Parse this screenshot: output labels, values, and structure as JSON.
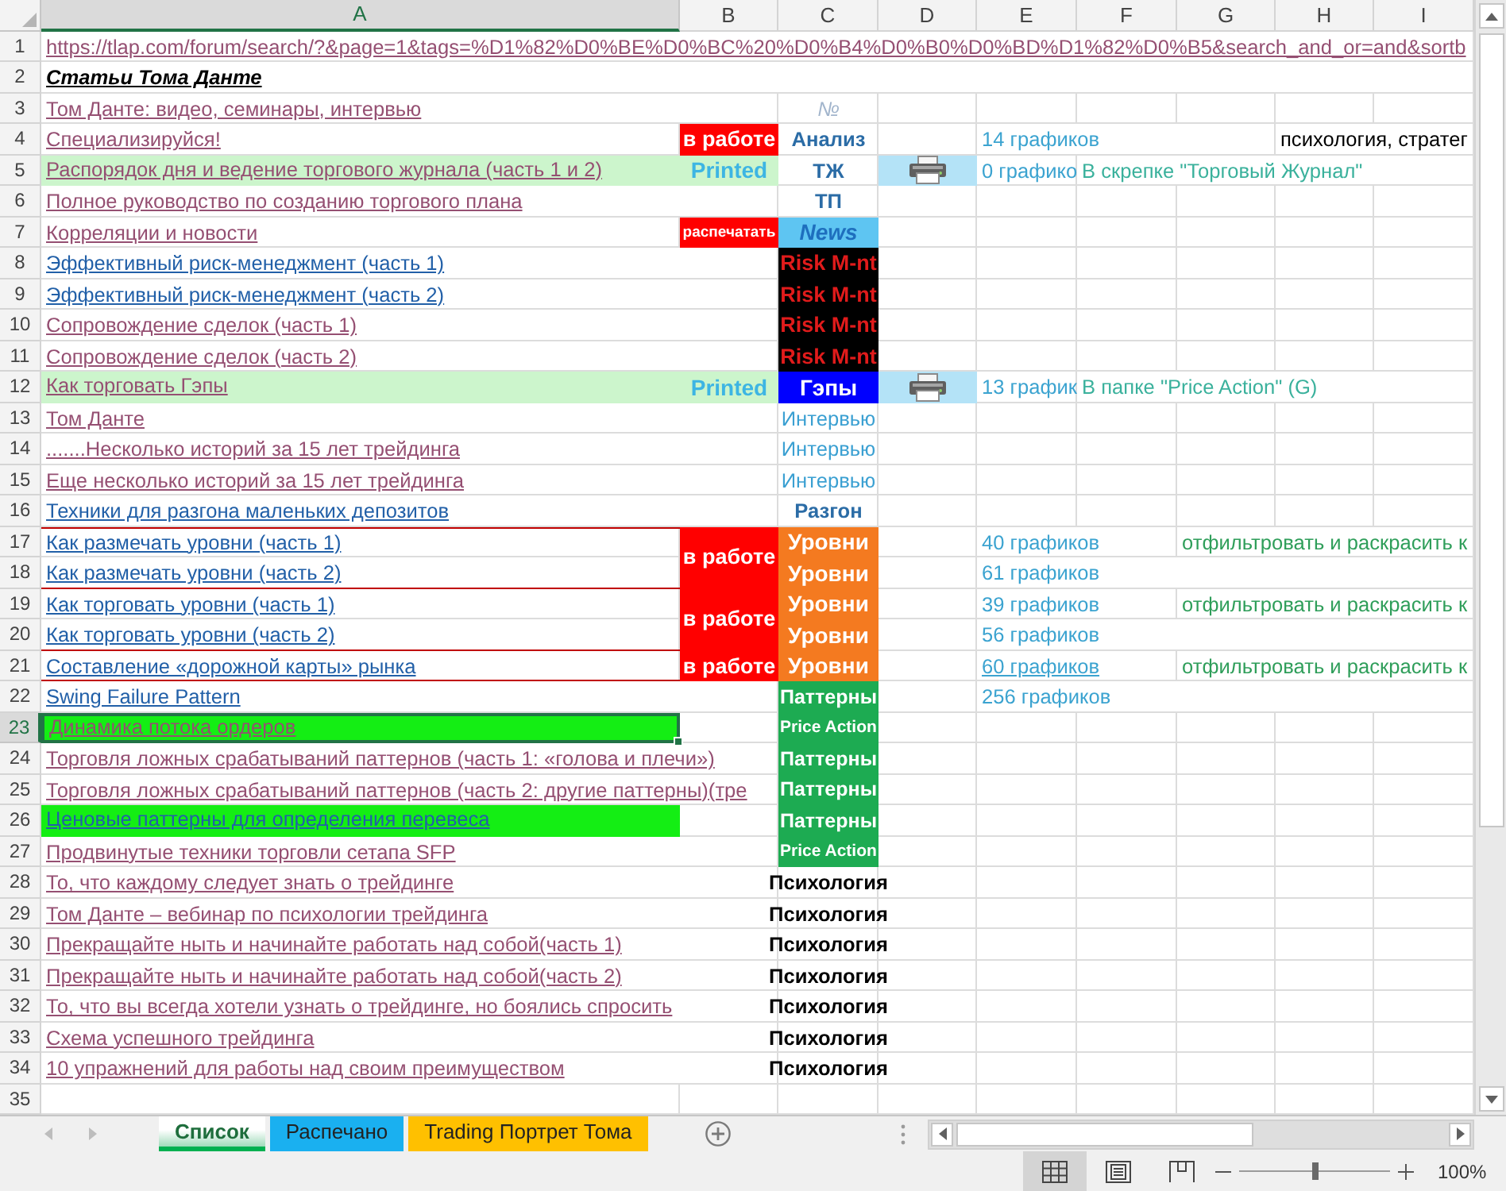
{
  "sheet": {
    "columns": [
      {
        "label": "A",
        "selected": true
      },
      {
        "label": "B",
        "selected": false
      },
      {
        "label": "C",
        "selected": false
      },
      {
        "label": "D",
        "selected": false
      },
      {
        "label": "E",
        "selected": false
      },
      {
        "label": "F",
        "selected": false
      },
      {
        "label": "G",
        "selected": false
      },
      {
        "label": "H",
        "selected": false
      },
      {
        "label": "I",
        "selected": false
      }
    ],
    "rows": [
      {
        "number": "1",
        "selected": false,
        "a": {
          "text": "https://tlap.com/forum/search/?&page=1&tags=%D1%82%D0%BE%D0%BC%20%D0%B4%D0%B0%D0%BD%D1%82%D0%B5&search_and_or=and&sortb",
          "link": true,
          "visited": true
        }
      },
      {
        "number": "2",
        "selected": false,
        "a": {
          "text": "Статьи Тома Данте",
          "bold": true,
          "italic": true,
          "underline": true
        }
      },
      {
        "number": "3",
        "selected": false,
        "a": {
          "text": "Том Данте: видео, семинары, интервью",
          "link": true,
          "visited": true
        },
        "c": {
          "text": "№",
          "italic": true,
          "ink": {
            "color": "#a2b5cc"
          }
        }
      },
      {
        "number": "4",
        "selected": false,
        "a": {
          "text": "Специализируйся!",
          "link": true,
          "visited": true
        },
        "b": {
          "text": "в работе",
          "bold": true,
          "color": "#ff0000",
          "ink": {
            "color": "#ffffff"
          }
        },
        "c": {
          "text": "Анализ",
          "bold": true,
          "ink": {
            "color": "#2b6ca6"
          }
        },
        "e": {
          "text": "14 графиков",
          "ink": {
            "color": "#3ba3d0"
          }
        },
        "h": {
          "text": "психология, стратег"
        }
      },
      {
        "number": "5",
        "selected": false,
        "a": {
          "text": "Распорядок дня и ведение торгового журнала (часть 1 и 2)",
          "link": true,
          "visited": true,
          "color": "#ccf5cc"
        },
        "b": {
          "text": "Printed",
          "bold": true,
          "color": "#ccf5cc",
          "ink": {
            "color": "#3db5e3"
          }
        },
        "c": {
          "text": "ТЖ",
          "bold": true,
          "ink": {
            "color": "#2b6ca6"
          }
        },
        "d": {
          "color": "#b4e3f7",
          "image": true
        },
        "e": {
          "text": "0 графико",
          "ink": {
            "color": "#3ba3d0"
          }
        },
        "f": {
          "text": "В скрепке \"Торговый Журнал\"",
          "ink": {
            "color": "#3ab19c"
          }
        }
      },
      {
        "number": "6",
        "selected": false,
        "a": {
          "text": "Полное руководство по созданию торгового плана",
          "link": true,
          "visited": true
        },
        "c": {
          "text": "ТП",
          "bold": true,
          "ink": {
            "color": "#2b6ca6"
          }
        }
      },
      {
        "number": "7",
        "selected": false,
        "a": {
          "text": "Корреляции и новости",
          "link": true,
          "visited": true
        },
        "b": {
          "text": "распечатать",
          "bold": true,
          "color": "#ff0000",
          "ink": {
            "color": "#ffffff"
          }
        },
        "c": {
          "text": "News",
          "bold": true,
          "italic": true,
          "color": "#5ec5f2",
          "ink": {
            "color": "#1e6fbe"
          }
        }
      },
      {
        "number": "8",
        "selected": false,
        "a": {
          "text": "Эффективный риск-менеджмент (часть 1)",
          "link": true,
          "visited": false
        },
        "c": {
          "text": "Risk M-nt",
          "bold": true,
          "color": "#000000",
          "ink": {
            "color": "#e01b1b"
          }
        }
      },
      {
        "number": "9",
        "selected": false,
        "a": {
          "text": "Эффективный риск-менеджмент (часть 2)",
          "link": true,
          "visited": false
        },
        "c": {
          "text": "Risk M-nt",
          "bold": true,
          "color": "#000000",
          "ink": {
            "color": "#e01b1b"
          }
        }
      },
      {
        "number": "10",
        "selected": false,
        "a": {
          "text": "Сопровождение сделок (часть 1)",
          "link": true,
          "visited": true
        },
        "c": {
          "text": "Risk M-nt",
          "bold": true,
          "color": "#000000",
          "ink": {
            "color": "#e01b1b"
          }
        }
      },
      {
        "number": "11",
        "selected": false,
        "a": {
          "text": "Сопровождение сделок (часть 2)",
          "link": true,
          "visited": true
        },
        "c": {
          "text": "Risk M-nt",
          "bold": true,
          "color": "#000000",
          "ink": {
            "color": "#e01b1b"
          }
        }
      },
      {
        "number": "12",
        "selected": false,
        "a": {
          "text": "Как торговать Гэпы",
          "link": true,
          "visited": true,
          "color": "#ccf5cc"
        },
        "b": {
          "text": "Printed",
          "bold": true,
          "color": "#ccf5cc",
          "ink": {
            "color": "#3db5e3"
          }
        },
        "c": {
          "text": "Гэпы",
          "bold": true,
          "color": "#0000ff",
          "ink": {
            "color": "#ffffff"
          }
        },
        "d": {
          "color": "#b4e3f7",
          "image": true
        },
        "e": {
          "text": "13 график",
          "ink": {
            "color": "#3ba3d0"
          }
        },
        "f": {
          "text": "В папке \"Price Action\" (G)",
          "ink": {
            "color": "#3ab19c"
          }
        }
      },
      {
        "number": "13",
        "selected": false,
        "a": {
          "text": "Том Данте",
          "link": true,
          "visited": true
        },
        "c": {
          "text": "Интервью",
          "ink": {
            "color": "#3ba0d2"
          }
        }
      },
      {
        "number": "14",
        "selected": false,
        "a": {
          "text": ".......Несколько историй за 15 лет трейдинга",
          "link": true,
          "visited": true
        },
        "c": {
          "text": "Интервью",
          "ink": {
            "color": "#3ba0d2"
          }
        }
      },
      {
        "number": "15",
        "selected": false,
        "a": {
          "text": "Еще несколько историй за 15 лет трейдинга",
          "link": true,
          "visited": true
        },
        "c": {
          "text": "Интервью",
          "ink": {
            "color": "#3ba0d2"
          }
        }
      },
      {
        "number": "16",
        "selected": false,
        "a": {
          "text": "Техники для разгона маленьких депозитов",
          "link": true,
          "visited": false
        },
        "c": {
          "text": "Разгон",
          "bold": true,
          "ink": {
            "color": "#2b6ca6"
          }
        }
      },
      {
        "number": "17",
        "selected": false,
        "a": {
          "text": "Как размечать уровни (часть 1)",
          "link": true,
          "visited": false
        },
        "b": {
          "text": "в работе",
          "bold": true,
          "color": "#ff0000",
          "ink": {
            "color": "#ffffff"
          },
          "merged_down": true,
          "framed": true
        },
        "c": {
          "text": "Уровни",
          "bold": true,
          "color": "#f47a20",
          "ink": {
            "color": "#ffffff"
          }
        },
        "e": {
          "text": "40 графиков",
          "ink": {
            "color": "#3ba3d0"
          }
        },
        "g": {
          "text": "отфильтровать и раскрасить к",
          "ink": {
            "color": "#2f9e5a"
          }
        }
      },
      {
        "number": "18",
        "selected": false,
        "a": {
          "text": "Как размечать уровни (часть 2)",
          "link": true,
          "visited": false
        },
        "c": {
          "text": "Уровни",
          "bold": true,
          "color": "#f47a20",
          "ink": {
            "color": "#ffffff"
          }
        },
        "e": {
          "text": "61 графиков",
          "ink": {
            "color": "#3ba3d0"
          }
        }
      },
      {
        "number": "19",
        "selected": false,
        "a": {
          "text": "Как торговать уровни (часть 1)",
          "link": true,
          "visited": false
        },
        "b": {
          "text": "в работе",
          "bold": true,
          "color": "#ff0000",
          "ink": {
            "color": "#ffffff"
          },
          "merged_down": true,
          "framed": true
        },
        "c": {
          "text": "Уровни",
          "bold": true,
          "color": "#f47a20",
          "ink": {
            "color": "#ffffff"
          }
        },
        "e": {
          "text": "39 графиков",
          "ink": {
            "color": "#3ba3d0"
          }
        },
        "g": {
          "text": "отфильтровать и раскрасить к",
          "ink": {
            "color": "#2f9e5a"
          }
        }
      },
      {
        "number": "20",
        "selected": false,
        "a": {
          "text": "Как торговать уровни (часть 2)",
          "link": true,
          "visited": false
        },
        "c": {
          "text": "Уровни",
          "bold": true,
          "color": "#f47a20",
          "ink": {
            "color": "#ffffff"
          }
        },
        "e": {
          "text": "56 графиков",
          "ink": {
            "color": "#3ba3d0"
          }
        }
      },
      {
        "number": "21",
        "selected": false,
        "a": {
          "text": "Составление «дорожной карты» рынка",
          "link": true,
          "visited": false
        },
        "b": {
          "text": "в работе",
          "bold": true,
          "color": "#ff0000",
          "ink": {
            "color": "#ffffff"
          },
          "framed": true
        },
        "c": {
          "text": "Уровни",
          "bold": true,
          "color": "#f47a20",
          "ink": {
            "color": "#ffffff"
          }
        },
        "e": {
          "text": "60 графиков",
          "underline": true,
          "ink": {
            "color": "#3ba3d0"
          }
        },
        "g": {
          "text": "отфильтровать и раскрасить к",
          "ink": {
            "color": "#2f9e5a"
          }
        }
      },
      {
        "number": "22",
        "selected": false,
        "a": {
          "text": "Swing Failure Pattern",
          "link": true,
          "visited": false
        },
        "c": {
          "text": "Паттерны",
          "bold": true,
          "color": "#1dab52",
          "ink": {
            "color": "#ffffff"
          }
        },
        "e": {
          "text": "256 графиков",
          "ink": {
            "color": "#3ba3d0"
          }
        }
      },
      {
        "number": "23",
        "selected": true,
        "a": {
          "text": "Динамика потока ордеров",
          "link": true,
          "visited": true,
          "color": "#14ee14"
        },
        "c": {
          "text": "Price Action",
          "bold": true,
          "color": "#1dab52",
          "ink": {
            "color": "#ffffff"
          }
        }
      },
      {
        "number": "24",
        "selected": false,
        "a": {
          "text": "Торговля ложных срабатываний паттернов (часть 1: «голова и плечи»)",
          "link": true,
          "visited": true
        },
        "c": {
          "text": "Паттерны",
          "bold": true,
          "color": "#1dab52",
          "ink": {
            "color": "#ffffff"
          }
        }
      },
      {
        "number": "25",
        "selected": false,
        "a": {
          "text": "Торговля ложных срабатываний паттернов (часть 2: другие паттерны)(тре",
          "link": true,
          "visited": true
        },
        "c": {
          "text": "Паттерны",
          "bold": true,
          "color": "#1dab52",
          "ink": {
            "color": "#ffffff"
          }
        }
      },
      {
        "number": "26",
        "selected": false,
        "a": {
          "text": "Ценовые паттерны для определения перевеса",
          "link": true,
          "visited": false,
          "color": "#14ee14"
        },
        "c": {
          "text": "Паттерны",
          "bold": true,
          "color": "#1dab52",
          "ink": {
            "color": "#ffffff"
          }
        }
      },
      {
        "number": "27",
        "selected": false,
        "a": {
          "text": "Продвинутые техники торговли сетапа SFP",
          "link": true,
          "visited": true
        },
        "c": {
          "text": "Price Action",
          "bold": true,
          "color": "#1dab52",
          "ink": {
            "color": "#ffffff"
          }
        }
      },
      {
        "number": "28",
        "selected": false,
        "a": {
          "text": "То, что каждому следует знать о трейдинге",
          "link": true,
          "visited": true
        },
        "c": {
          "text": "Психология",
          "bold": true
        }
      },
      {
        "number": "29",
        "selected": false,
        "a": {
          "text": "Том Данте – вебинар по психологии трейдинга",
          "link": true,
          "visited": true
        },
        "c": {
          "text": "Психология",
          "bold": true
        }
      },
      {
        "number": "30",
        "selected": false,
        "a": {
          "text": "Прекращайте ныть и начинайте работать над собой(часть 1)",
          "link": true,
          "visited": true
        },
        "c": {
          "text": "Психология",
          "bold": true
        }
      },
      {
        "number": "31",
        "selected": false,
        "a": {
          "text": "Прекращайте ныть и начинайте работать над собой(часть 2)",
          "link": true,
          "visited": true
        },
        "c": {
          "text": "Психология",
          "bold": true
        }
      },
      {
        "number": "32",
        "selected": false,
        "a": {
          "text": "То, что вы всегда хотели узнать о трейдинге, но боялись спросить",
          "link": true,
          "visited": true
        },
        "c": {
          "text": "Психология",
          "bold": true
        }
      },
      {
        "number": "33",
        "selected": false,
        "a": {
          "text": "Схема успешного трейдинга",
          "link": true,
          "visited": true
        },
        "c": {
          "text": "Психология",
          "bold": true
        }
      },
      {
        "number": "34",
        "selected": false,
        "a": {
          "text": "10 упражнений для работы над своим преимуществом",
          "link": true,
          "visited": true
        },
        "c": {
          "text": "Психология",
          "bold": true
        }
      },
      {
        "number": "35",
        "selected": false
      }
    ]
  },
  "sheet_tabs": [
    {
      "label": "Список",
      "selected": true,
      "color": "#00b050"
    },
    {
      "label": "Распечано",
      "selected": false,
      "color": "#1ab0f0"
    },
    {
      "label": "Trading Портрет Тома",
      "selected": false,
      "color": "#ffc000"
    }
  ],
  "status_bar": {
    "views": [
      {
        "selected": true
      },
      {
        "selected": false
      },
      {
        "selected": false
      }
    ],
    "zoom": {
      "level": 0.5,
      "reading": "100%"
    }
  }
}
